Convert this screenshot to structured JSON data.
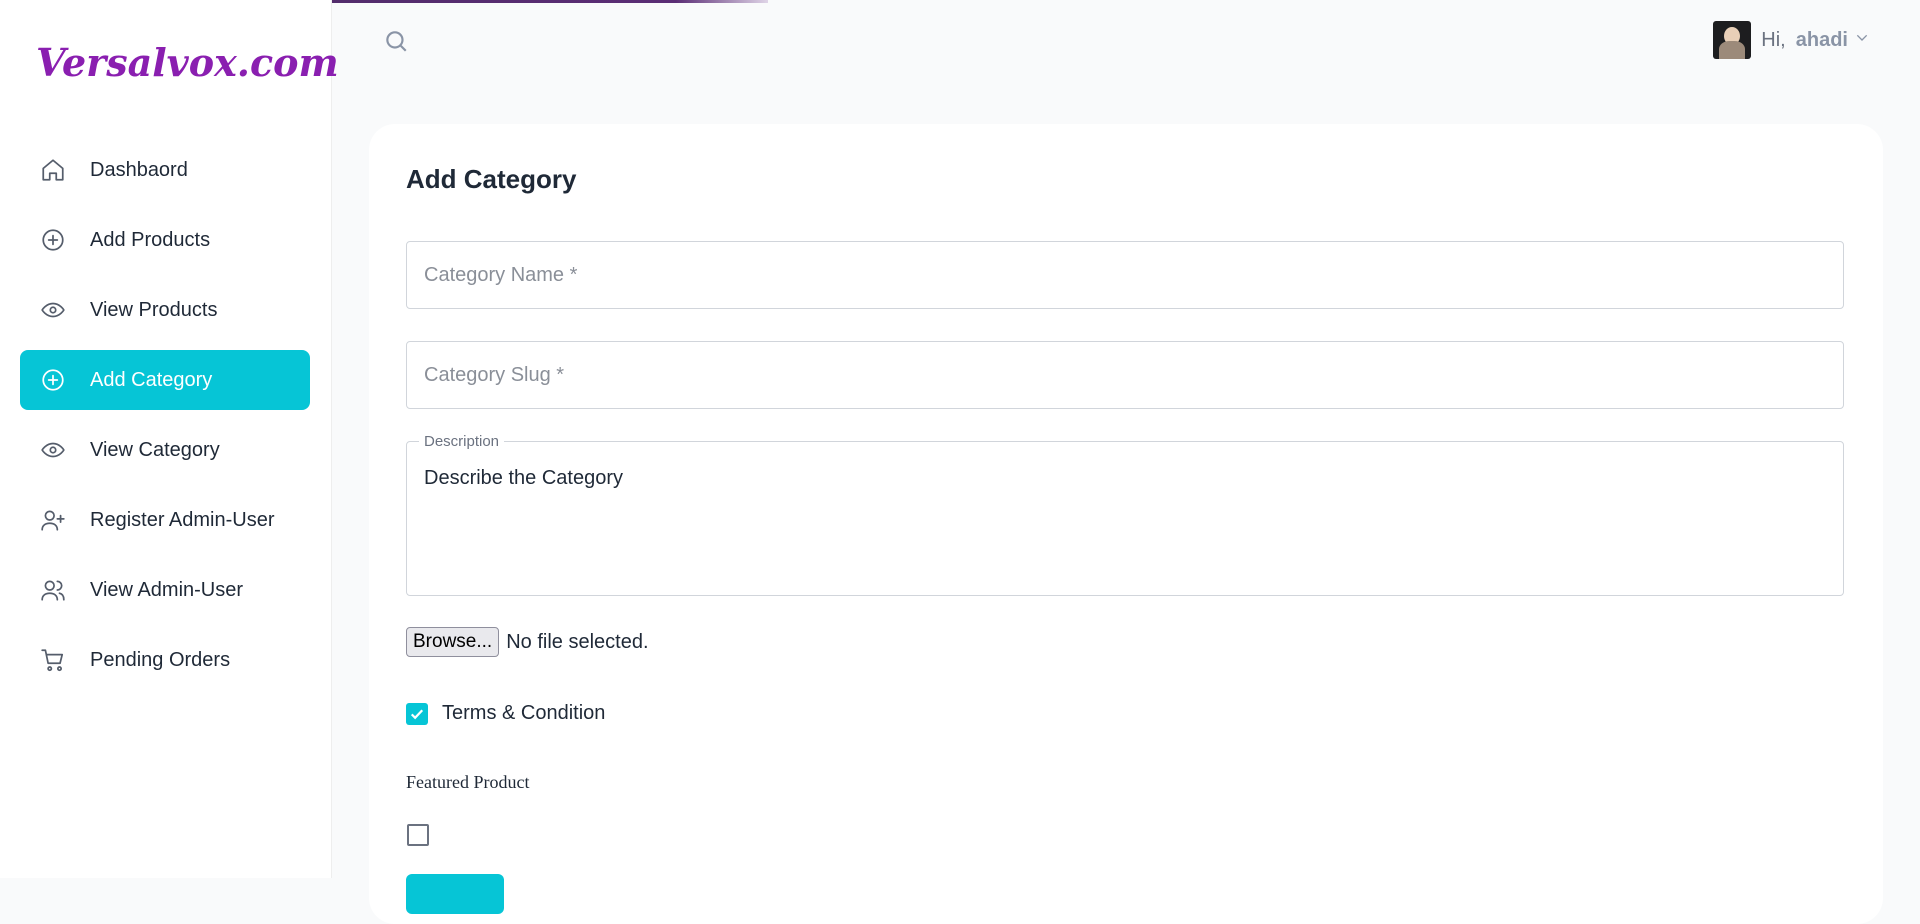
{
  "brand": {
    "logo_text": "Versalvox.com"
  },
  "header": {
    "greeting": "Hi,",
    "username": "ahadi"
  },
  "sidebar": {
    "items": [
      {
        "label": "Dashbaord",
        "icon": "home-icon",
        "active": false
      },
      {
        "label": "Add Products",
        "icon": "plus-circle-icon",
        "active": false
      },
      {
        "label": "View Products",
        "icon": "eye-icon",
        "active": false
      },
      {
        "label": "Add Category",
        "icon": "plus-circle-icon",
        "active": true
      },
      {
        "label": "View Category",
        "icon": "eye-icon",
        "active": false
      },
      {
        "label": "Register Admin-User",
        "icon": "user-plus-icon",
        "active": false
      },
      {
        "label": "View Admin-User",
        "icon": "users-icon",
        "active": false
      },
      {
        "label": "Pending Orders",
        "icon": "cart-icon",
        "active": false
      }
    ]
  },
  "form": {
    "title": "Add Category",
    "category_name_placeholder": "Category Name *",
    "category_slug_placeholder": "Category Slug *",
    "description_label": "Description",
    "description_value": "Describe the Category",
    "browse_label": "Browse...",
    "file_status": "No file selected.",
    "terms_label": "Terms & Condition",
    "terms_checked": true,
    "featured_label": "Featured Product",
    "featured_checked": false
  },
  "colors": {
    "accent": "#06c5d6",
    "brand": "#8a1fb0",
    "sidebar_bg": "#ffffff",
    "page_bg": "#f9fafb"
  }
}
